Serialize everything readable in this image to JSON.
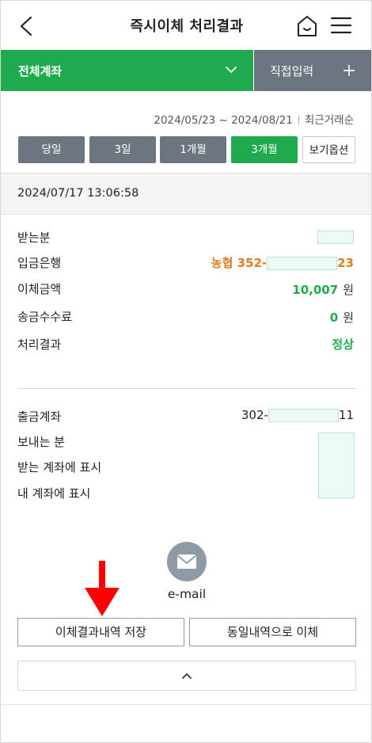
{
  "header": {
    "title": "즉시이체 처리결과"
  },
  "account_bar": {
    "selected_account": "전체계좌",
    "direct_input": "직접입력"
  },
  "date_range": {
    "range": "2024/05/23 ~ 2024/08/21",
    "recent_order": "최근거래순"
  },
  "periods": [
    {
      "label": "당일",
      "active": false
    },
    {
      "label": "3일",
      "active": false
    },
    {
      "label": "1개월",
      "active": false
    },
    {
      "label": "3개월",
      "active": true
    }
  ],
  "view_options": "보기옵션",
  "transaction_datetime": "2024/07/17 13:06:58",
  "details": {
    "recipient_label": "받는분",
    "bank_label": "입금은행",
    "bank_prefix": "농협 352-",
    "bank_suffix": "23",
    "amount_label": "이체금액",
    "amount_value": "10,007",
    "amount_unit": "원",
    "fee_label": "송금수수료",
    "fee_value": "0",
    "fee_unit": "원",
    "result_label": "처리결과",
    "result_value": "정상"
  },
  "sender": {
    "withdraw_label": "출금계좌",
    "withdraw_prefix": "302-",
    "withdraw_suffix": "11",
    "sender_label": "보내는 분",
    "recipient_display_label": "받는 계좌에 표시",
    "my_display_label": "내 계좌에 표시"
  },
  "email": {
    "label": "e-mail"
  },
  "buttons": {
    "save_history": "이체결과내역 저장",
    "same_transfer": "동일내역으로 이체"
  },
  "colors": {
    "green": "#1faa4e",
    "gray": "#6d7580",
    "orange": "#e27a23",
    "red_arrow": "#ff0000",
    "mask": "#e9fbf3"
  }
}
